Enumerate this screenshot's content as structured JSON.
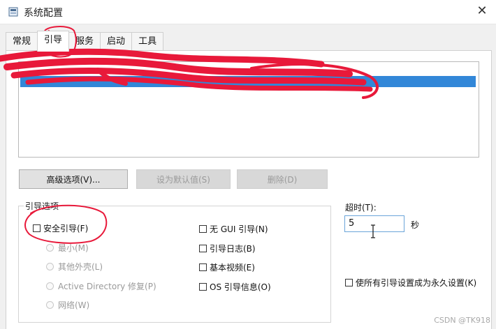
{
  "window": {
    "title": "系统配置",
    "close_glyph": "✕"
  },
  "tabs": [
    {
      "label": "常规",
      "active": false
    },
    {
      "label": "引导",
      "active": true
    },
    {
      "label": "服务",
      "active": false
    },
    {
      "label": "启动",
      "active": false
    },
    {
      "label": "工具",
      "active": false
    }
  ],
  "buttons": {
    "advanced": "高级选项(V)...",
    "set_default": "设为默认值(S)",
    "delete": "删除(D)"
  },
  "boot_options": {
    "group_title": "引导选项",
    "safe_boot": "安全引导(F)",
    "radios": {
      "minimal": "最小(M)",
      "alternate_shell": "其他外壳(L)",
      "ad_repair": "Active Directory 修复(P)",
      "network": "网络(W)"
    },
    "no_gui": "无 GUI 引导(N)",
    "boot_log": "引导日志(B)",
    "base_video": "基本视频(E)",
    "os_boot_info": "OS 引导信息(O)"
  },
  "timeout": {
    "label": "超时(T):",
    "value": "5",
    "unit": "秒"
  },
  "permanent": {
    "label": "使所有引导设置成为永久设置(K)"
  },
  "watermark": "CSDN @TK918",
  "colors": {
    "selection": "#3287d8",
    "annotation": "#e8193a"
  },
  "icons": {
    "app": "msconfig-icon",
    "close": "close-icon"
  }
}
